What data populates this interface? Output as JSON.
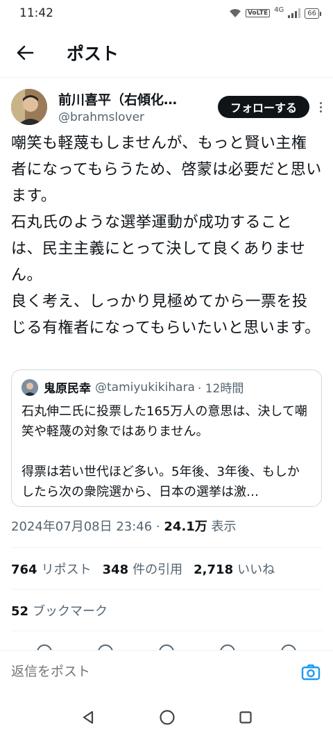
{
  "status": {
    "time": "11:42",
    "network": "4G",
    "volte": "VoLTE",
    "battery": "66"
  },
  "header": {
    "title": "ポスト",
    "back_icon": "arrow-left-icon"
  },
  "author": {
    "name": "前川喜平（右傾化…",
    "handle": "@brahmslover",
    "follow_label": "フォローする"
  },
  "tweet": {
    "paragraphs": [
      "嘲笑も軽蔑もしませんが、もっと賢い主権者になってもらうため、啓蒙は必要だと思います。",
      "石丸氏のような選挙運動が成功することは、民主主義にとって決して良くありません。",
      "良く考え、しっかり見極めてから一票を投じる有権者になってもらいたいと思います。"
    ]
  },
  "quote": {
    "name": "鬼原民幸",
    "handle": "@tamiyukikihara",
    "time": "· 12時間",
    "text1": "石丸伸二氏に投票した165万人の意思は、決して嘲笑や軽蔑の対象ではありません。",
    "text2": "得票は若い世代ほど多い。5年後、3年後、もしかしたら次の衆院選から、日本の選挙は激…"
  },
  "meta": {
    "datetime": "2024年07月08日 23:46 · ",
    "views": "24.1万",
    "views_label": " 表示"
  },
  "stats": {
    "reposts": "764",
    "reposts_label": "リポスト",
    "quotes": "348",
    "quotes_label": "件の引用",
    "likes": "2,718",
    "likes_label": "いいね",
    "bookmarks": "52",
    "bookmarks_label": "ブックマーク"
  },
  "reply": {
    "placeholder": "返信をポスト"
  }
}
